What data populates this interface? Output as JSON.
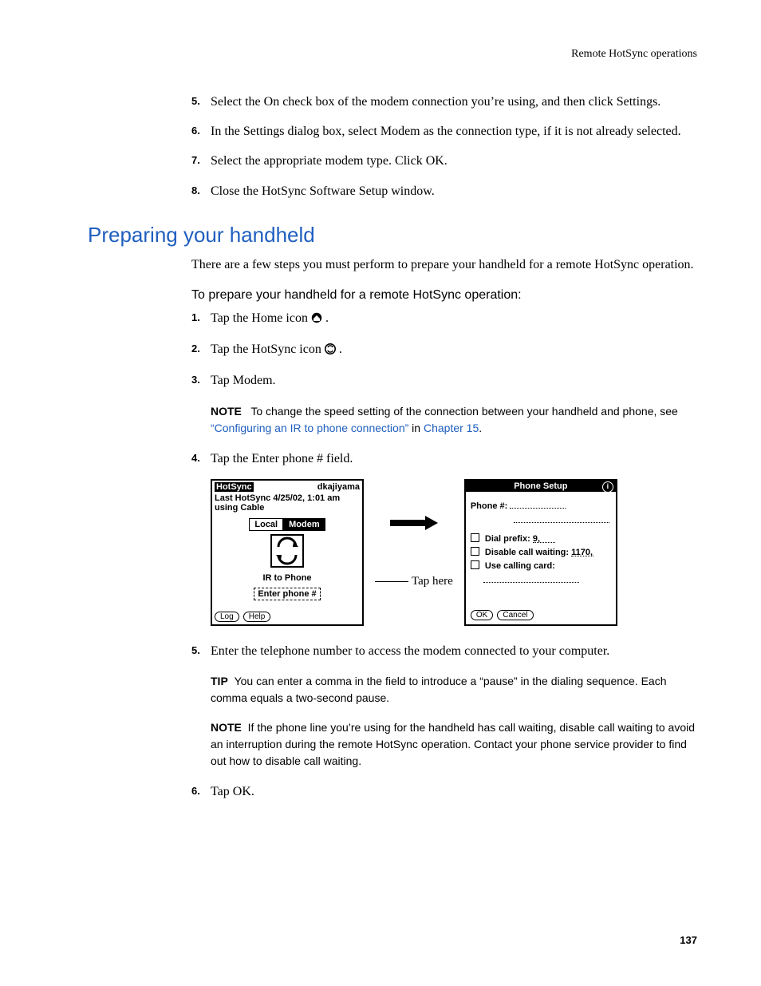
{
  "runningHead": "Remote HotSync operations",
  "topList": {
    "items": [
      {
        "n": "5.",
        "t": "Select the On check box of the modem connection you’re using, and then click Settings."
      },
      {
        "n": "6.",
        "t": "In the Settings dialog box, select Modem as the connection type, if it is not already selected."
      },
      {
        "n": "7.",
        "t": "Select the appropriate modem type. Click OK."
      },
      {
        "n": "8.",
        "t": "Close the HotSync Software Setup window."
      }
    ]
  },
  "sectionHeading": "Preparing your handheld",
  "sectionIntro": "There are a few steps you must perform to prepare your handheld for a remote HotSync operation.",
  "subhead": "To prepare your handheld for a remote HotSync operation:",
  "steps123": [
    {
      "n": "1.",
      "pre": "Tap the Home icon ",
      "post": "."
    },
    {
      "n": "2.",
      "pre": "Tap the HotSync icon ",
      "post": "."
    },
    {
      "n": "3.",
      "pre": "Tap Modem.",
      "post": ""
    }
  ],
  "note1": {
    "label": "NOTE",
    "pre": "To change the speed setting of the connection between your handheld and phone, see ",
    "link1": "“Configuring an IR to phone connection”",
    "mid": " in ",
    "link2": "Chapter 15",
    "post": "."
  },
  "step4": {
    "n": "4.",
    "t": "Tap the Enter phone # field."
  },
  "fig": {
    "hotsync": {
      "title": "HotSync",
      "user": "dkajiyama",
      "lastLine": "Last HotSync 4/25/02, 1:01 am using Cable",
      "tabLocal": "Local",
      "tabModem": "Modem",
      "conn": "IR to Phone",
      "phoneField": "Enter phone #",
      "btnLog": "Log",
      "btnHelp": "Help"
    },
    "tapHere": "Tap here",
    "phoneSetup": {
      "title": "Phone Setup",
      "phoneLabel": "Phone #:",
      "dialPrefix": "Dial prefix:",
      "dialPrefixVal": "9,",
      "disableCW": "Disable call waiting:",
      "disableCWVal": "1170,",
      "useCard": "Use calling card:",
      "ok": "OK",
      "cancel": "Cancel"
    }
  },
  "step5": {
    "n": "5.",
    "t": "Enter the telephone number to access the modem connected to your computer."
  },
  "tip": {
    "label": "TIP",
    "t": "You can enter a comma in the field to introduce a “pause” in the dialing sequence. Each comma equals a two-second pause."
  },
  "note2": {
    "label": "NOTE",
    "t": "If the phone line you’re using for the handheld has call waiting, disable call waiting to avoid an interruption during the remote HotSync operation. Contact your phone service provider to find out how to disable call waiting."
  },
  "step6": {
    "n": "6.",
    "t": "Tap OK."
  },
  "pageNumber": "137"
}
